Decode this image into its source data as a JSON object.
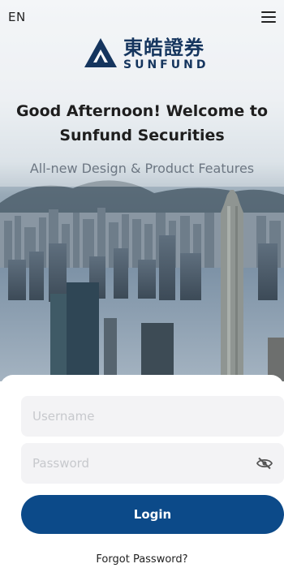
{
  "header": {
    "language": "EN"
  },
  "brand": {
    "name_cn": "東皓證券",
    "name_en": "SUNFUND",
    "primary_color": "#15355e"
  },
  "hero": {
    "greeting_line1": "Good Afternoon!  Welcome to",
    "greeting_line2": "Sunfund Securities",
    "tagline": "All-new Design & Product Features"
  },
  "login_form": {
    "username_placeholder": "Username",
    "password_placeholder": "Password",
    "login_label": "Login",
    "forgot_label": "Forgot Password?",
    "button_color": "#0c4a89"
  },
  "icons": {
    "menu": "hamburger-menu-icon",
    "password_visibility": "eye-off-icon"
  }
}
